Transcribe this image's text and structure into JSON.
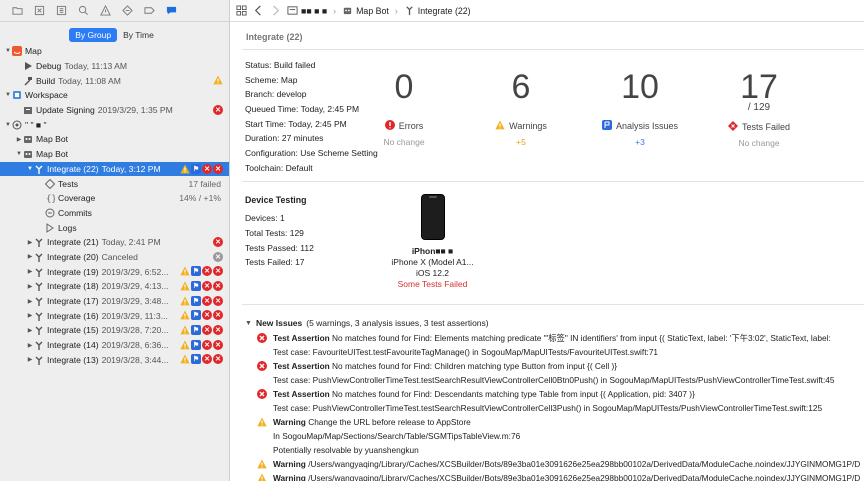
{
  "sidebar": {
    "toolbar_icons": [
      "folder-icon",
      "close-box-icon",
      "hierarchy-icon",
      "search-icon",
      "warning-icon",
      "test-diamond-icon",
      "breakpoint-tag-icon",
      "speech-bubble-icon"
    ],
    "segment": {
      "by_group": "By Group",
      "by_time": "By Time"
    },
    "rows": [
      {
        "label": "Map",
        "meta": "",
        "level": 0,
        "disclosure": "open",
        "icon": "swift-icon"
      },
      {
        "label": "Debug",
        "meta": "Today, 11:13 AM",
        "level": 1,
        "icon": "play-icon"
      },
      {
        "label": "Build",
        "meta": "Today, 11:08 AM",
        "level": 1,
        "icon": "hammer-icon",
        "badges": [
          "warn"
        ]
      },
      {
        "label": "Workspace",
        "meta": "",
        "level": 0,
        "disclosure": "open",
        "icon": "workspace-icon"
      },
      {
        "label": "Update Signing",
        "meta": "2019/3/29, 1:35 PM",
        "level": 1,
        "icon": "archive-icon",
        "badges": [
          "err"
        ]
      },
      {
        "label": "\" \" ■ \"",
        "meta": "",
        "level": 0,
        "disclosure": "open",
        "icon": "server-icon"
      },
      {
        "label": "Map Bot",
        "meta": "",
        "level": 1,
        "disclosure": "closed",
        "icon": "bot-icon"
      },
      {
        "label": "Map Bot",
        "meta": "",
        "level": 1,
        "disclosure": "open",
        "icon": "bot-icon"
      },
      {
        "label": "Integrate (22)",
        "meta": "Today, 3:12 PM",
        "level": 2,
        "disclosure": "open",
        "icon": "integrate-icon",
        "selected": true,
        "badges": [
          "warn",
          "ana",
          "err",
          "err"
        ]
      },
      {
        "label": "Tests",
        "meta": "",
        "level": 3,
        "icon": "test-diamond-icon",
        "right": "17 failed"
      },
      {
        "label": "Coverage",
        "meta": "",
        "level": 3,
        "icon": "braces-icon",
        "right": "14% / +1%"
      },
      {
        "label": "Commits",
        "meta": "",
        "level": 3,
        "icon": "commit-icon"
      },
      {
        "label": "Logs",
        "meta": "",
        "level": 3,
        "icon": "log-icon"
      },
      {
        "label": "Integrate (21)",
        "meta": "Today, 2:41 PM",
        "level": 2,
        "disclosure": "closed",
        "icon": "integrate-icon",
        "badges": [
          "err"
        ]
      },
      {
        "label": "Integrate (20)",
        "meta": "Canceled",
        "level": 2,
        "disclosure": "closed",
        "icon": "integrate-icon",
        "badges": [
          "grey"
        ]
      },
      {
        "label": "Integrate (19)",
        "meta": "2019/3/29, 6:52...",
        "level": 2,
        "disclosure": "closed",
        "icon": "integrate-icon",
        "badges": [
          "warn",
          "ana",
          "err",
          "err"
        ]
      },
      {
        "label": "Integrate (18)",
        "meta": "2019/3/29, 4:13...",
        "level": 2,
        "disclosure": "closed",
        "icon": "integrate-icon",
        "badges": [
          "warn",
          "ana",
          "err",
          "err"
        ]
      },
      {
        "label": "Integrate (17)",
        "meta": "2019/3/29, 3:48...",
        "level": 2,
        "disclosure": "closed",
        "icon": "integrate-icon",
        "badges": [
          "warn",
          "ana",
          "err",
          "err"
        ]
      },
      {
        "label": "Integrate (16)",
        "meta": "2019/3/29, 11:3...",
        "level": 2,
        "disclosure": "closed",
        "icon": "integrate-icon",
        "badges": [
          "warn",
          "ana",
          "err",
          "err"
        ]
      },
      {
        "label": "Integrate (15)",
        "meta": "2019/3/28, 7:20...",
        "level": 2,
        "disclosure": "closed",
        "icon": "integrate-icon",
        "badges": [
          "warn",
          "ana",
          "err",
          "err"
        ]
      },
      {
        "label": "Integrate (14)",
        "meta": "2019/3/28, 6:36...",
        "level": 2,
        "disclosure": "closed",
        "icon": "integrate-icon",
        "badges": [
          "warn",
          "ana",
          "err",
          "err"
        ]
      },
      {
        "label": "Integrate (13)",
        "meta": "2019/3/28, 3:44...",
        "level": 2,
        "disclosure": "closed",
        "icon": "integrate-icon",
        "badges": [
          "warn",
          "ana",
          "err",
          "err"
        ]
      }
    ]
  },
  "jumpbar": {
    "server": "■■ ■ ■",
    "bot": "Map Bot",
    "integration": "Integrate (22)"
  },
  "main": {
    "section_title": "Integrate (22)",
    "info": [
      "Status: Build failed",
      "Scheme: Map",
      "Branch: develop",
      "Queued Time: Today, 2:45 PM",
      "Start Time: Today, 2:45 PM",
      "Duration: 27 minutes",
      "Configuration: Use Scheme Setting",
      "Toolchain: Default"
    ],
    "stats": [
      {
        "value": "0",
        "label": "Errors",
        "change": "No change",
        "icon": "error-icon"
      },
      {
        "value": "6",
        "label": "Warnings",
        "change": "+5",
        "icon": "warning-icon"
      },
      {
        "value": "10",
        "label": "Analysis Issues",
        "change": "+3",
        "icon": "analysis-icon"
      },
      {
        "value": "17",
        "of": "/ 129",
        "label": "Tests Failed",
        "change": "No change",
        "icon": "tests-failed-icon"
      }
    ],
    "device_testing": {
      "title": "Device Testing",
      "lines": [
        "Devices: 1",
        "Total Tests: 129",
        "Tests Passed: 112",
        "Tests Failed: 17"
      ],
      "device_name": "iPhon■■ ■",
      "device_model": "iPhone X (Model A1...",
      "device_os": "iOS 12.2",
      "device_status": "Some Tests Failed"
    },
    "issues": {
      "header_bold": "New Issues",
      "header_rest": "(5 warnings, 3 analysis issues, 3 test assertions)",
      "items": [
        {
          "type": "error",
          "title": "Test Assertion",
          "text": "No matches found for Find: Elements matching predicate '\"标签\" IN identifiers' from input {(     StaticText, label: '下午3:02',     StaticText, label:",
          "detail": "Test case: FavouriteUITest.testFavouriteTagManage() in SogouMap/MapUITests/FavouriteUITest.swift:71"
        },
        {
          "type": "error",
          "title": "Test Assertion",
          "text": "No matches found for Find: Children matching type Button from input {(     Cell )}",
          "detail": "Test case: PushViewControllerTimeTest.testSearchResultViewControllerCell0Btn0Push() in SogouMap/MapUITests/PushViewControllerTimeTest.swift:45"
        },
        {
          "type": "error",
          "title": "Test Assertion",
          "text": "No matches found for Find: Descendants matching type Table from input {(     Application, pid: 3407 )}",
          "detail": "Test case: PushViewControllerTimeTest.testSearchResultViewControllerCell3Push() in SogouMap/MapUITests/PushViewControllerTimeTest.swift:125"
        },
        {
          "type": "warning",
          "title": "Warning",
          "text": "Change the URL before release to AppStore",
          "detail": "In SogouMap/Map/Sections/Search/Table/SGMTipsTableView.m:76",
          "detail2": "Potentially resolvable by yuanshengkun"
        },
        {
          "type": "warning",
          "title": "Warning",
          "text": "/Users/wangyaqing/Library/Caches/XCSBuilder/Bots/89e3ba01e3091626e25ea298bb00102a/DerivedData/ModuleCache.noindex/JJYGINMOMG1P/D"
        },
        {
          "type": "warning",
          "title": "Warning",
          "text": "/Users/wangyaqing/Library/Caches/XCSBuilder/Bots/89e3ba01e3091626e25ea298bb00102a/DerivedData/ModuleCache.noindex/JJYGINMOMG1P/D"
        }
      ]
    }
  },
  "colors": {
    "selection": "#2f7de1",
    "error": "#e0272a",
    "warning": "#f2b01e",
    "analysis": "#2d6ad9"
  }
}
